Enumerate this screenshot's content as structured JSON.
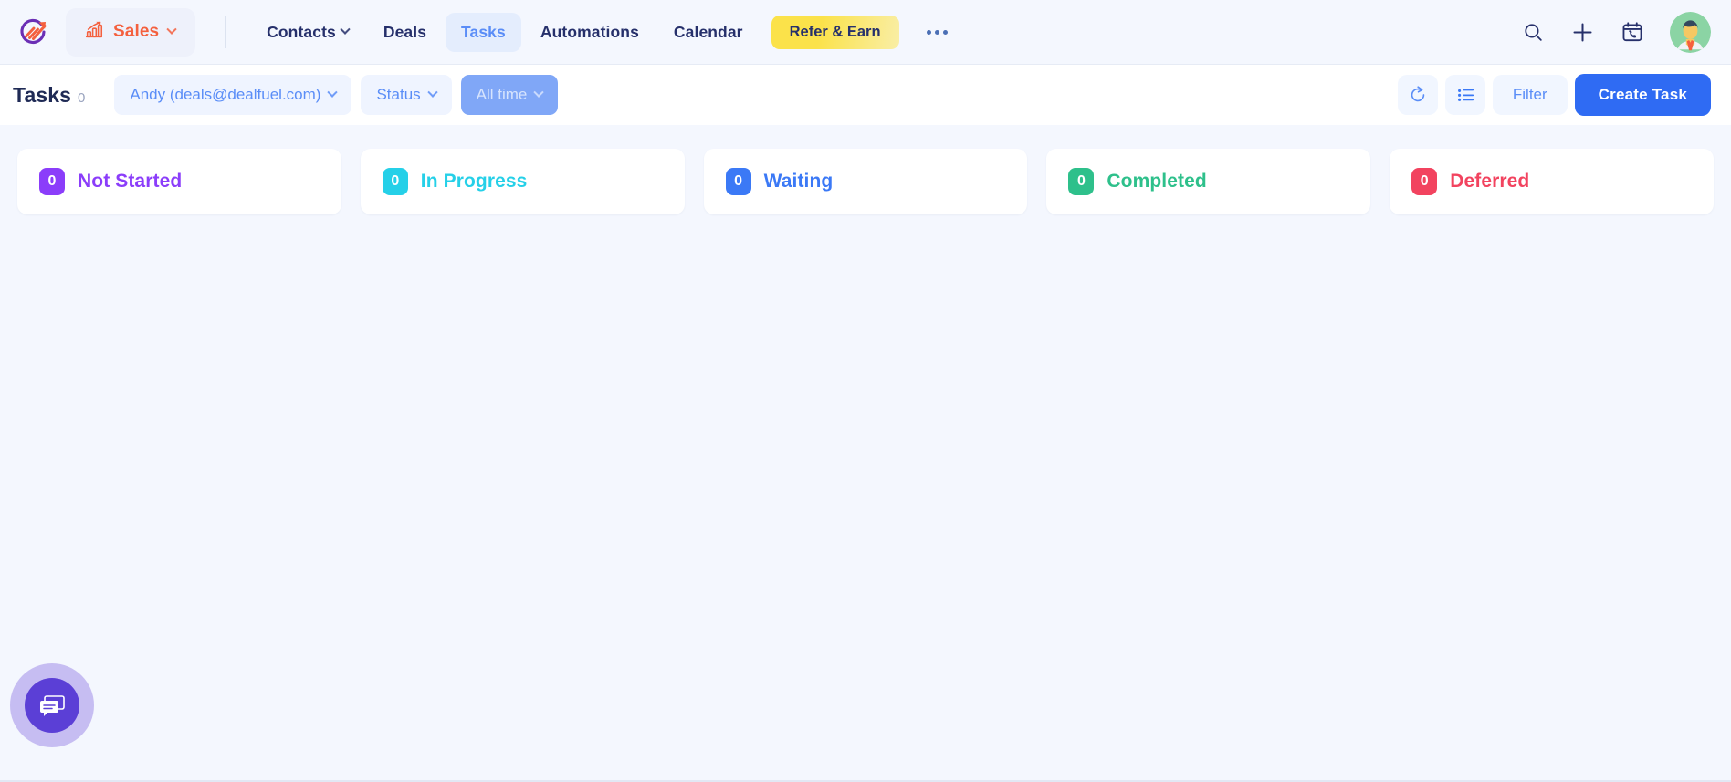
{
  "brand": {
    "logo_icon": "dealfuel-arrow-logo",
    "module_label": "Sales",
    "module_icon": "bar-chart-up-icon",
    "accent_orange": "#f4603e",
    "accent_purple": "#5b3fd6"
  },
  "nav": {
    "items": [
      {
        "label": "Contacts",
        "has_caret": true,
        "active": false
      },
      {
        "label": "Deals",
        "has_caret": false,
        "active": false
      },
      {
        "label": "Tasks",
        "has_caret": false,
        "active": true
      },
      {
        "label": "Automations",
        "has_caret": false,
        "active": false
      },
      {
        "label": "Calendar",
        "has_caret": false,
        "active": false
      }
    ],
    "refer_label": "Refer & Earn",
    "overflow_icon": "more-horizontal-icon",
    "right_icons": [
      {
        "name": "search-icon"
      },
      {
        "name": "plus-icon"
      },
      {
        "name": "calendar-call-icon"
      }
    ],
    "avatar_icon": "user-avatar"
  },
  "toolbar": {
    "title": "Tasks",
    "count": "0",
    "owner_filter": "Andy (deals@dealfuel.com)",
    "status_filter": "Status",
    "time_filter": "All time",
    "refresh_icon": "refresh-icon",
    "view_icon": "list-view-icon",
    "filter_label": "Filter",
    "create_label": "Create Task"
  },
  "board": {
    "cards": [
      {
        "count": "0",
        "label": "Not Started",
        "color": "#8b3dfa"
      },
      {
        "count": "0",
        "label": "In Progress",
        "color": "#25d0e8"
      },
      {
        "count": "0",
        "label": "Waiting",
        "color": "#3b79f6"
      },
      {
        "count": "0",
        "label": "Completed",
        "color": "#2ec08b"
      },
      {
        "count": "0",
        "label": "Deferred",
        "color": "#f2435f"
      }
    ]
  },
  "chat": {
    "icon": "chat-bubble-icon"
  }
}
